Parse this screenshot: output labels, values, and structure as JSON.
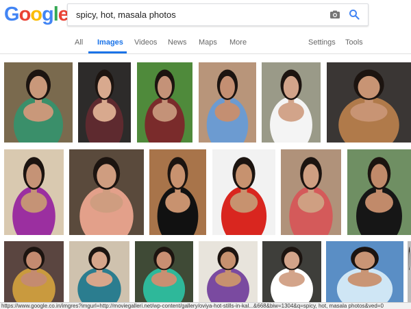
{
  "logo": {
    "letters": [
      "G",
      "o",
      "o",
      "g",
      "l",
      "e"
    ],
    "colors": [
      "#4285F4",
      "#EA4335",
      "#FBBC05",
      "#4285F4",
      "#34A853",
      "#EA4335"
    ]
  },
  "search": {
    "value": "spicy, hot, masala photos",
    "camera_icon": "camera-icon",
    "search_icon": "search-icon"
  },
  "tabs": {
    "all": "All",
    "images": "Images",
    "videos": "Videos",
    "news": "News",
    "maps": "Maps",
    "more": "More",
    "settings": "Settings",
    "tools": "Tools"
  },
  "accent_color": "#1a73e8",
  "status_bar": {
    "url": "https://www.google.co.in/imgres?imgurl=http://moviegalleri.net/wp-content/gallery/oviya-hot-stills-in-kal...&668&biw=1304&q=spicy, hot, masala photos&ved=0"
  },
  "images": [
    {
      "bg": "#7a6a4e",
      "fg": "#c9987a",
      "accent": "#3a8f6a"
    },
    {
      "bg": "#2d2b2a",
      "fg": "#d8a98e",
      "accent": "#5e2a2f"
    },
    {
      "bg": "#4f8a3b",
      "fg": "#c49278",
      "accent": "#7a2b2b"
    },
    {
      "bg": "#b8957a",
      "fg": "#c48f72",
      "accent": "#6c9bd1"
    },
    {
      "bg": "#9a9a88",
      "fg": "#d2a48a",
      "accent": "#f4f4f4"
    },
    {
      "bg": "#3a3634",
      "fg": "#c89474",
      "accent": "#b07a4a"
    },
    {
      "bg": "#d9c9b0",
      "fg": "#c59376",
      "accent": "#9b2fa0"
    },
    {
      "bg": "#5a4a3c",
      "fg": "#cf9d80",
      "accent": "#e3a08a"
    },
    {
      "bg": "#a8744a",
      "fg": "#c8926f",
      "accent": "#111111"
    },
    {
      "bg": "#f2f2f2",
      "fg": "#c7926f",
      "accent": "#d9261f"
    },
    {
      "bg": "#b0927a",
      "fg": "#cf9f82",
      "accent": "#d45a5a"
    },
    {
      "bg": "#6f8f63",
      "fg": "#c18a6a",
      "accent": "#161616"
    },
    {
      "bg": "#5a4540",
      "fg": "#c48b70",
      "accent": "#c99a3e"
    },
    {
      "bg": "#cfc2ae",
      "fg": "#d7a68b",
      "accent": "#2b7d8f"
    },
    {
      "bg": "#3f4a36",
      "fg": "#c98f72",
      "accent": "#2eb89a"
    },
    {
      "bg": "#e8e4dc",
      "fg": "#c7916f",
      "accent": "#7a4aa0"
    },
    {
      "bg": "#3e3e3a",
      "fg": "#d3a48a",
      "accent": "#ffffff"
    },
    {
      "bg": "#5a8ec5",
      "fg": "#c99575",
      "accent": "#cfe6f5"
    },
    {
      "bg": "#bbbbbb",
      "fg": "#bbbbbb",
      "accent": "#bbbbbb"
    }
  ]
}
